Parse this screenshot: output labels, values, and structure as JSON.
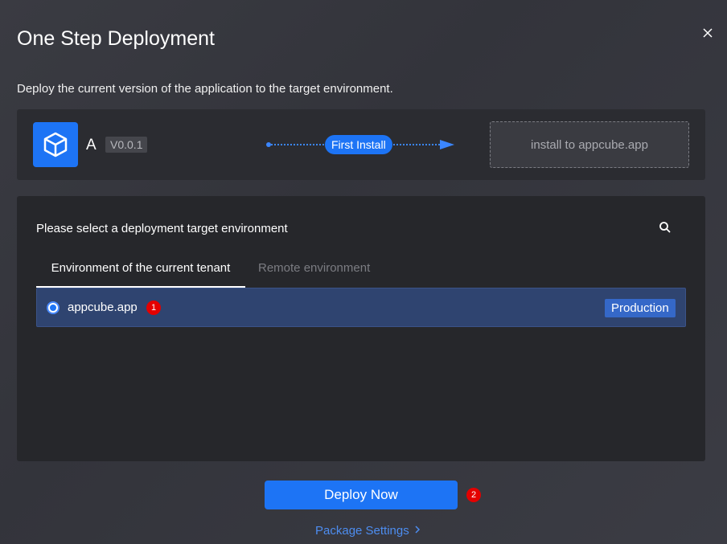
{
  "dialog": {
    "title": "One Step Deployment",
    "subtitle": "Deploy the current version of the application to the target environment."
  },
  "app": {
    "name": "A",
    "version": "V0.0.1",
    "flow_label": "First Install",
    "target_text": "install to appcube.app"
  },
  "environment": {
    "heading": "Please select a deployment target environment",
    "tabs": [
      {
        "label": "Environment of the current tenant",
        "active": true
      },
      {
        "label": "Remote environment",
        "active": false
      }
    ],
    "items": [
      {
        "name": "appcube.app",
        "tag": "Production",
        "selected": true,
        "marker": "1"
      }
    ]
  },
  "actions": {
    "deploy_label": "Deploy Now",
    "deploy_marker": "2",
    "package_settings_label": "Package Settings"
  },
  "icons": {
    "close": "close-icon",
    "app": "cube-icon",
    "search": "search-icon",
    "chevron": "chevron-right-icon"
  },
  "colors": {
    "accent": "#1d74f5",
    "marker": "#e40000",
    "selected_row": "#2f4470",
    "tag": "#3568c8"
  }
}
